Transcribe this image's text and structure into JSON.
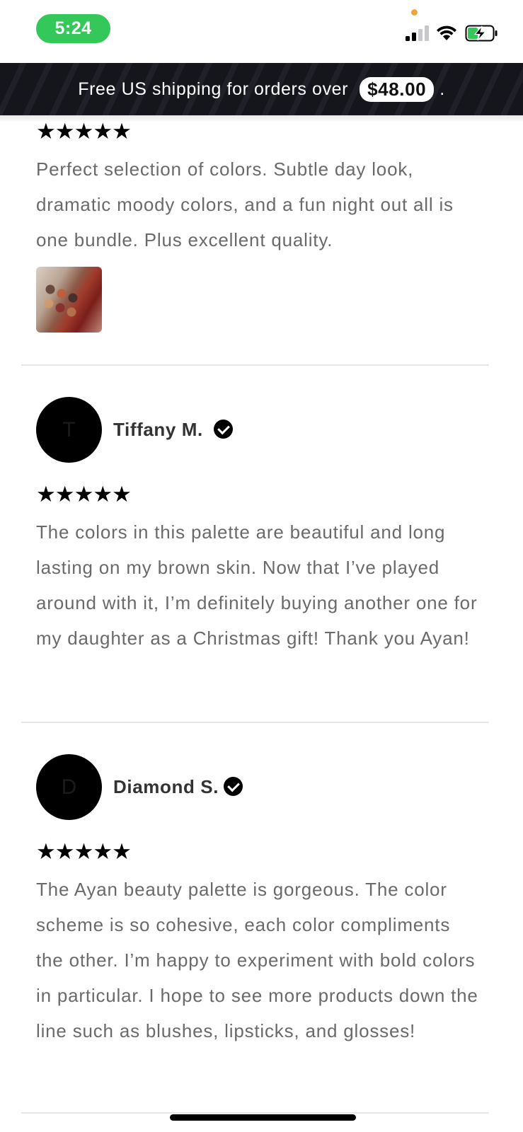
{
  "status_bar": {
    "time": "5:24",
    "time_pill_color": "#34c759",
    "icons": [
      "signal-icon",
      "wifi-icon",
      "battery-charging-icon"
    ]
  },
  "announcement": {
    "text": "Free US shipping for orders over",
    "amount": "$48.00",
    "suffix": "."
  },
  "reviews": [
    {
      "rating": 5,
      "stars": "★★★★★",
      "text": "Perfect selection of colors. Subtle day look, dramatic moody colors, and a fun night out all is one bundle. Plus excellent quality.",
      "has_photo": true
    },
    {
      "avatar_initial": "T",
      "name": "Tiffany M.",
      "verified": true,
      "rating": 5,
      "stars": "★★★★★",
      "text": "The colors in this palette are beautiful and long lasting on my brown skin. Now that I’ve played around with it, I’m definitely buying another one for my daughter as a Christmas gift! Thank you Ayan!"
    },
    {
      "avatar_initial": "D",
      "name": "Diamond S.",
      "verified": true,
      "rating": 5,
      "stars": "★★★★★",
      "text": "The Ayan beauty palette is gorgeous. The color scheme is so cohesive, each color compliments the other. I’m happy to experiment with bold colors in particular. I hope to see more products down the line such as blushes, lipsticks, and glosses!"
    }
  ]
}
